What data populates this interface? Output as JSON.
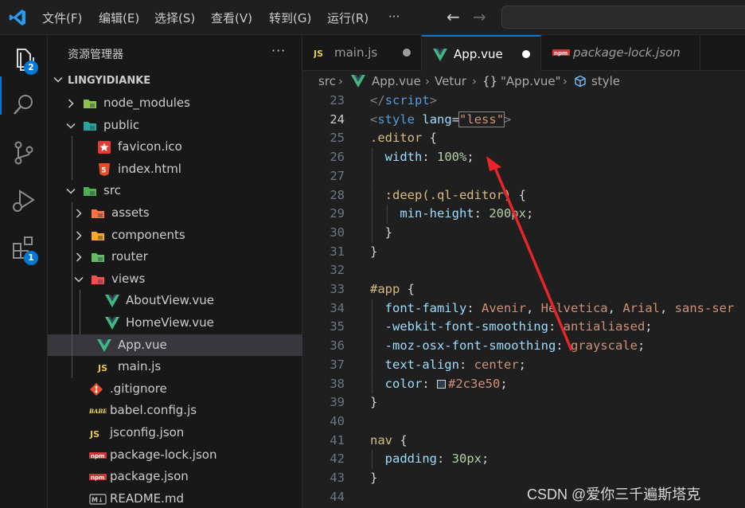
{
  "menu": [
    "文件(F)",
    "编辑(E)",
    "选择(S)",
    "查看(V)",
    "转到(G)",
    "运行(R)",
    "···"
  ],
  "activity_badges": {
    "explorer": "2",
    "extensions": "1"
  },
  "sidebar": {
    "title": "资源管理器",
    "more": "···",
    "project": "LINGYIDIANKE",
    "tree": [
      {
        "label": "node_modules",
        "depth": 0,
        "kind": "folder",
        "open": false,
        "icon": "node-modules-folder-icon"
      },
      {
        "label": "public",
        "depth": 0,
        "kind": "folder",
        "open": true,
        "icon": "public-folder-icon"
      },
      {
        "label": "favicon.ico",
        "depth": 1,
        "kind": "file",
        "icon": "favicon-star-icon"
      },
      {
        "label": "index.html",
        "depth": 1,
        "kind": "file",
        "icon": "html5-icon"
      },
      {
        "label": "src",
        "depth": 0,
        "kind": "folder",
        "open": true,
        "icon": "src-folder-icon"
      },
      {
        "label": "assets",
        "depth": 1,
        "kind": "folder",
        "open": false,
        "icon": "assets-folder-icon"
      },
      {
        "label": "components",
        "depth": 1,
        "kind": "folder",
        "open": false,
        "icon": "components-folder-icon"
      },
      {
        "label": "router",
        "depth": 1,
        "kind": "folder",
        "open": false,
        "icon": "router-folder-icon"
      },
      {
        "label": "views",
        "depth": 1,
        "kind": "folder",
        "open": true,
        "icon": "views-folder-icon"
      },
      {
        "label": "AboutView.vue",
        "depth": 2,
        "kind": "file",
        "icon": "vue-icon"
      },
      {
        "label": "HomeView.vue",
        "depth": 2,
        "kind": "file",
        "icon": "vue-icon"
      },
      {
        "label": "App.vue",
        "depth": 1,
        "kind": "file",
        "icon": "vue-icon",
        "selected": true
      },
      {
        "label": "main.js",
        "depth": 1,
        "kind": "file",
        "icon": "js-icon"
      },
      {
        "label": ".gitignore",
        "depth": 0,
        "kind": "file",
        "icon": "git-icon"
      },
      {
        "label": "babel.config.js",
        "depth": 0,
        "kind": "file",
        "icon": "babel-icon"
      },
      {
        "label": "jsconfig.json",
        "depth": 0,
        "kind": "file",
        "icon": "js-config-icon"
      },
      {
        "label": "package-lock.json",
        "depth": 0,
        "kind": "file",
        "icon": "npm-icon"
      },
      {
        "label": "package.json",
        "depth": 0,
        "kind": "file",
        "icon": "npm-icon"
      },
      {
        "label": "README.md",
        "depth": 0,
        "kind": "file",
        "icon": "markdown-icon"
      }
    ]
  },
  "tabs": [
    {
      "label": "main.js",
      "icon_text": "JS",
      "dirty": true,
      "active": false
    },
    {
      "label": "App.vue",
      "icon_text": "V",
      "dirty": true,
      "active": true
    },
    {
      "label": "package-lock.json",
      "icon_text": "npm",
      "dirty": false,
      "active": false
    }
  ],
  "breadcrumb": {
    "folder": "src",
    "file": "App.vue",
    "lang": "Vetur",
    "section_glyph": "{}",
    "section": "\"App.vue\"",
    "symbol": "style"
  },
  "editor": {
    "current_line": 24,
    "lines": [
      {
        "n": 23,
        "indent": 0,
        "tokens": [
          [
            "tag",
            "</"
          ],
          [
            "tagname",
            "script"
          ],
          [
            "tag",
            ">"
          ]
        ]
      },
      {
        "n": 24,
        "indent": 0,
        "tokens": [
          [
            "tag",
            "<"
          ],
          [
            "tagname",
            "style"
          ],
          [
            "punc",
            " "
          ],
          [
            "attr",
            "lang"
          ],
          [
            "punc",
            "="
          ],
          [
            "str",
            "\"less\""
          ],
          [
            "tag",
            ">"
          ]
        ]
      },
      {
        "n": 25,
        "indent": 0,
        "tokens": [
          [
            "sel",
            ".editor"
          ],
          [
            "punc",
            " {"
          ]
        ]
      },
      {
        "n": 26,
        "indent": 1,
        "tokens": [
          [
            "prop",
            "width"
          ],
          [
            "punc",
            ": "
          ],
          [
            "num",
            "100%"
          ],
          [
            "punc",
            ";"
          ]
        ]
      },
      {
        "n": 27,
        "indent": 1,
        "tokens": []
      },
      {
        "n": 28,
        "indent": 1,
        "tokens": [
          [
            "sel",
            ":deep(.ql-editor)"
          ],
          [
            "punc",
            " {"
          ]
        ]
      },
      {
        "n": 29,
        "indent": 2,
        "tokens": [
          [
            "prop",
            "min-height"
          ],
          [
            "punc",
            ": "
          ],
          [
            "num",
            "200px"
          ],
          [
            "punc",
            ";"
          ]
        ]
      },
      {
        "n": 30,
        "indent": 1,
        "tokens": [
          [
            "punc",
            "}"
          ]
        ]
      },
      {
        "n": 31,
        "indent": 0,
        "tokens": [
          [
            "punc",
            "}"
          ]
        ]
      },
      {
        "n": 32,
        "indent": 0,
        "tokens": []
      },
      {
        "n": 33,
        "indent": 0,
        "tokens": [
          [
            "sel",
            "#app"
          ],
          [
            "punc",
            " {"
          ]
        ]
      },
      {
        "n": 34,
        "indent": 1,
        "tokens": [
          [
            "prop",
            "font-family"
          ],
          [
            "punc",
            ": "
          ],
          [
            "val",
            "Avenir"
          ],
          [
            "punc",
            ", "
          ],
          [
            "val",
            "Helvetica"
          ],
          [
            "punc",
            ", "
          ],
          [
            "val",
            "Arial"
          ],
          [
            "punc",
            ", "
          ],
          [
            "val",
            "sans-ser"
          ]
        ]
      },
      {
        "n": 35,
        "indent": 1,
        "tokens": [
          [
            "prop",
            "-webkit-font-smoothing"
          ],
          [
            "punc",
            ": "
          ],
          [
            "val",
            "antialiased"
          ],
          [
            "punc",
            ";"
          ]
        ]
      },
      {
        "n": 36,
        "indent": 1,
        "tokens": [
          [
            "prop",
            "-moz-osx-font-smoothing"
          ],
          [
            "punc",
            ": "
          ],
          [
            "val",
            "grayscale"
          ],
          [
            "punc",
            ";"
          ]
        ]
      },
      {
        "n": 37,
        "indent": 1,
        "tokens": [
          [
            "prop",
            "text-align"
          ],
          [
            "punc",
            ": "
          ],
          [
            "val",
            "center"
          ],
          [
            "punc",
            ";"
          ]
        ]
      },
      {
        "n": 38,
        "indent": 1,
        "tokens": [
          [
            "prop",
            "color"
          ],
          [
            "punc",
            ": "
          ],
          [
            "swatch",
            ""
          ],
          [
            "val",
            "#2c3e50"
          ],
          [
            "punc",
            ";"
          ]
        ]
      },
      {
        "n": 39,
        "indent": 0,
        "tokens": [
          [
            "punc",
            "}"
          ]
        ]
      },
      {
        "n": 40,
        "indent": 0,
        "tokens": []
      },
      {
        "n": 41,
        "indent": 0,
        "tokens": [
          [
            "sel",
            "nav"
          ],
          [
            "punc",
            " {"
          ]
        ]
      },
      {
        "n": 42,
        "indent": 1,
        "tokens": [
          [
            "prop",
            "padding"
          ],
          [
            "punc",
            ": "
          ],
          [
            "num",
            "30px"
          ],
          [
            "punc",
            ";"
          ]
        ]
      },
      {
        "n": 43,
        "indent": 0,
        "tokens": [
          [
            "punc",
            "}"
          ]
        ]
      },
      {
        "n": 44,
        "indent": 0,
        "tokens": []
      }
    ]
  },
  "annotation_color": "#e8242b",
  "watermark": "CSDN @爱你三千遍斯塔克"
}
